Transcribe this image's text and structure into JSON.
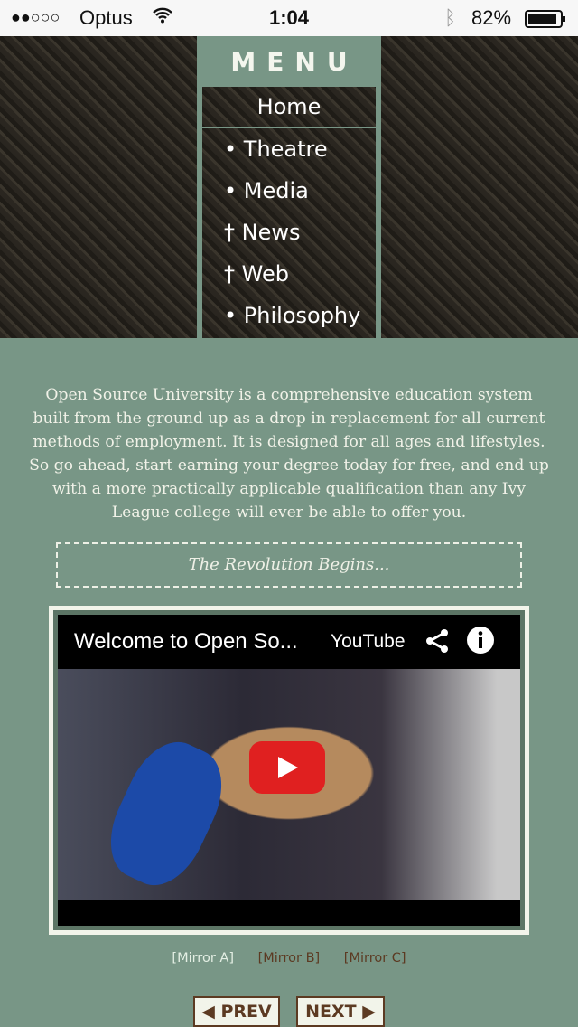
{
  "status_bar": {
    "signal": "●●○○○",
    "carrier": "Optus",
    "time": "1:04",
    "battery": "82%"
  },
  "menu": {
    "title": "MENU",
    "home": "Home",
    "items": [
      {
        "marker": "•",
        "label": "Theatre"
      },
      {
        "marker": "•",
        "label": "Media"
      },
      {
        "marker": "†",
        "label": "News"
      },
      {
        "marker": "†",
        "label": "Web"
      },
      {
        "marker": "•",
        "label": "Philosophy"
      }
    ]
  },
  "intro": "Open Source University is a comprehensive education system built from the ground up as a drop in replacement for all current methods of employment. It is designed for all ages and lifestyles. So go ahead, start earning your degree today for free, and end up with a more practically applicable qualification than any Ivy League college will ever be able to offer you.",
  "tagline": "The Revolution Begins...",
  "video": {
    "title": "Welcome to Open So...",
    "brand": "YouTube"
  },
  "mirrors": [
    "[Mirror A]",
    "[Mirror B]",
    "[Mirror C]"
  ],
  "colors": {
    "mirror_active": "#e4efe4",
    "mirror_inactive": "#5c3a22"
  },
  "nav": {
    "prev": "PREV",
    "next": "NEXT"
  }
}
